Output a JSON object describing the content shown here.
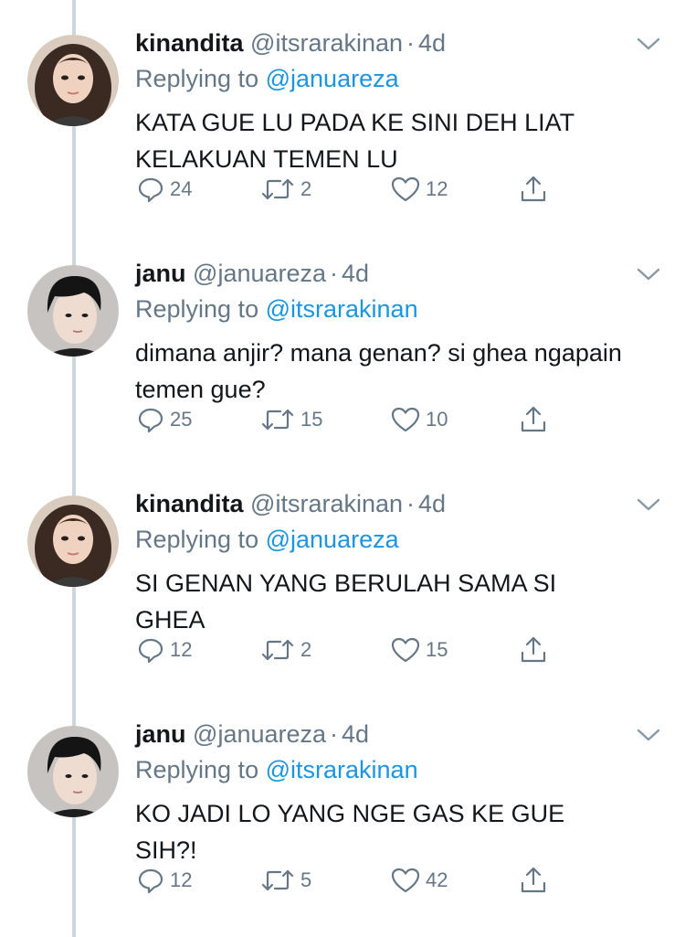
{
  "tweets": [
    {
      "name": "kinandita",
      "handle": "@itsrarakinan",
      "dot": "·",
      "time": "4d",
      "replying_prefix": "Replying to",
      "replying_to": "@januareza",
      "text": "KATA GUE LU PADA KE SINI DEH LIAT KELAKUAN TEMEN LU",
      "replies": "24",
      "retweets": "2",
      "likes": "12",
      "avatar": "female-avatar-icon"
    },
    {
      "name": "janu",
      "handle": "@januareza",
      "dot": "·",
      "time": "4d",
      "replying_prefix": "Replying to",
      "replying_to": "@itsrarakinan",
      "text": "dimana anjir? mana genan? si ghea ngapain temen gue?",
      "replies": "25",
      "retweets": "15",
      "likes": "10",
      "avatar": "male-avatar-icon"
    },
    {
      "name": "kinandita",
      "handle": "@itsrarakinan",
      "dot": "·",
      "time": "4d",
      "replying_prefix": "Replying to",
      "replying_to": "@januareza",
      "text": "SI GENAN YANG BERULAH SAMA SI GHEA",
      "replies": "12",
      "retweets": "2",
      "likes": "15",
      "avatar": "female-avatar-icon"
    },
    {
      "name": "janu",
      "handle": "@januareza",
      "dot": "·",
      "time": "4d",
      "replying_prefix": "Replying to",
      "replying_to": "@itsrarakinan",
      "text": "KO JADI LO YANG NGE GAS KE GUE SIH?!",
      "replies": "12",
      "retweets": "5",
      "likes": "42",
      "avatar": "male-avatar-icon"
    }
  ],
  "colors": {
    "text": "#14171a",
    "secondary": "#657786",
    "link": "#1b95e0",
    "thread_line": "#ccd6dd"
  }
}
